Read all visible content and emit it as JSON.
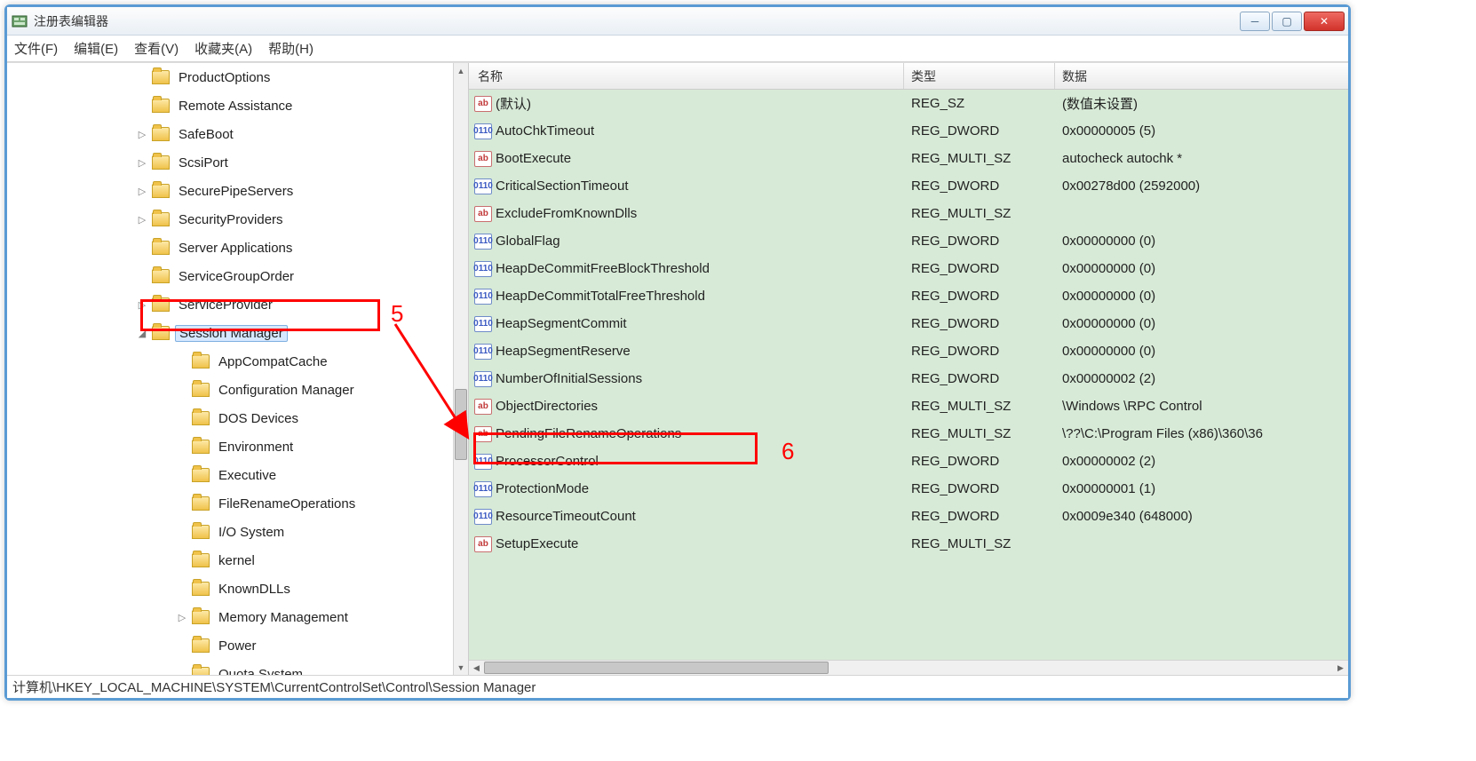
{
  "titlebar": {
    "title": "注册表编辑器"
  },
  "menu": {
    "file": "文件(F)",
    "edit": "编辑(E)",
    "view": "查看(V)",
    "favorites": "收藏夹(A)",
    "help": "帮助(H)"
  },
  "tree": [
    {
      "label": "ProductOptions",
      "expander": "",
      "level": 0
    },
    {
      "label": "Remote Assistance",
      "expander": "",
      "level": 0
    },
    {
      "label": "SafeBoot",
      "expander": "▷",
      "level": 0
    },
    {
      "label": "ScsiPort",
      "expander": "▷",
      "level": 0
    },
    {
      "label": "SecurePipeServers",
      "expander": "▷",
      "level": 0
    },
    {
      "label": "SecurityProviders",
      "expander": "▷",
      "level": 0
    },
    {
      "label": "Server Applications",
      "expander": "",
      "level": 0
    },
    {
      "label": "ServiceGroupOrder",
      "expander": "",
      "level": 0
    },
    {
      "label": "ServiceProvider",
      "expander": "▷",
      "level": 0
    },
    {
      "label": "Session Manager",
      "expander": "◢",
      "level": 0,
      "selected": true
    },
    {
      "label": "AppCompatCache",
      "expander": "",
      "level": 1
    },
    {
      "label": "Configuration Manager",
      "expander": "",
      "level": 1
    },
    {
      "label": "DOS Devices",
      "expander": "",
      "level": 1
    },
    {
      "label": "Environment",
      "expander": "",
      "level": 1
    },
    {
      "label": "Executive",
      "expander": "",
      "level": 1
    },
    {
      "label": "FileRenameOperations",
      "expander": "",
      "level": 1
    },
    {
      "label": "I/O System",
      "expander": "",
      "level": 1
    },
    {
      "label": "kernel",
      "expander": "",
      "level": 1
    },
    {
      "label": "KnownDLLs",
      "expander": "",
      "level": 1
    },
    {
      "label": "Memory Management",
      "expander": "▷",
      "level": 1
    },
    {
      "label": "Power",
      "expander": "",
      "level": 1
    },
    {
      "label": "Quota System",
      "expander": "",
      "level": 1
    }
  ],
  "columns": {
    "name": "名称",
    "type": "类型",
    "data": "数据"
  },
  "values": [
    {
      "name": "(默认)",
      "type": "REG_SZ",
      "data": "(数值未设置)",
      "icon": "sz"
    },
    {
      "name": "AutoChkTimeout",
      "type": "REG_DWORD",
      "data": "0x00000005 (5)",
      "icon": "dw"
    },
    {
      "name": "BootExecute",
      "type": "REG_MULTI_SZ",
      "data": "autocheck autochk *",
      "icon": "sz"
    },
    {
      "name": "CriticalSectionTimeout",
      "type": "REG_DWORD",
      "data": "0x00278d00 (2592000)",
      "icon": "dw"
    },
    {
      "name": "ExcludeFromKnownDlls",
      "type": "REG_MULTI_SZ",
      "data": "",
      "icon": "sz"
    },
    {
      "name": "GlobalFlag",
      "type": "REG_DWORD",
      "data": "0x00000000 (0)",
      "icon": "dw"
    },
    {
      "name": "HeapDeCommitFreeBlockThreshold",
      "type": "REG_DWORD",
      "data": "0x00000000 (0)",
      "icon": "dw"
    },
    {
      "name": "HeapDeCommitTotalFreeThreshold",
      "type": "REG_DWORD",
      "data": "0x00000000 (0)",
      "icon": "dw"
    },
    {
      "name": "HeapSegmentCommit",
      "type": "REG_DWORD",
      "data": "0x00000000 (0)",
      "icon": "dw"
    },
    {
      "name": "HeapSegmentReserve",
      "type": "REG_DWORD",
      "data": "0x00000000 (0)",
      "icon": "dw"
    },
    {
      "name": "NumberOfInitialSessions",
      "type": "REG_DWORD",
      "data": "0x00000002 (2)",
      "icon": "dw"
    },
    {
      "name": "ObjectDirectories",
      "type": "REG_MULTI_SZ",
      "data": "\\Windows \\RPC Control",
      "icon": "sz"
    },
    {
      "name": "PendingFileRenameOperations",
      "type": "REG_MULTI_SZ",
      "data": "\\??\\C:\\Program Files (x86)\\360\\36",
      "icon": "sz"
    },
    {
      "name": "ProcessorControl",
      "type": "REG_DWORD",
      "data": "0x00000002 (2)",
      "icon": "dw"
    },
    {
      "name": "ProtectionMode",
      "type": "REG_DWORD",
      "data": "0x00000001 (1)",
      "icon": "dw"
    },
    {
      "name": "ResourceTimeoutCount",
      "type": "REG_DWORD",
      "data": "0x0009e340 (648000)",
      "icon": "dw"
    },
    {
      "name": "SetupExecute",
      "type": "REG_MULTI_SZ",
      "data": "",
      "icon": "sz"
    }
  ],
  "statusbar": "计算机\\HKEY_LOCAL_MACHINE\\SYSTEM\\CurrentControlSet\\Control\\Session Manager",
  "annotations": {
    "label5": "5",
    "label6": "6"
  },
  "icon_text": {
    "sz": "ab",
    "dw": "0110"
  }
}
